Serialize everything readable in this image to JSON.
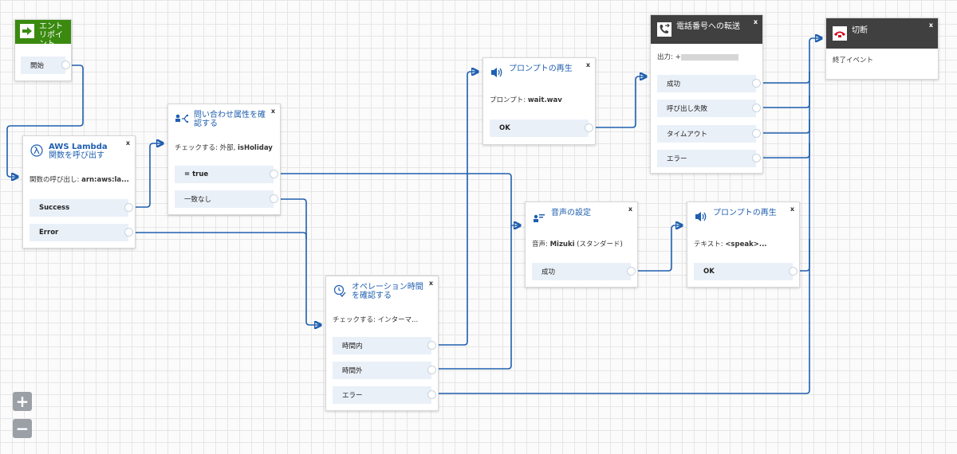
{
  "entry": {
    "title": "エントリポイント",
    "branch": "開始"
  },
  "lambda": {
    "title_line1": "AWS Lambda",
    "title_line2": "関数を呼び出す",
    "desc_prefix": "関数の呼び出し: ",
    "desc_value": "arn:aws:la...",
    "branches": [
      "Success",
      "Error"
    ]
  },
  "check_attr": {
    "title": "問い合わせ属性を確認する",
    "desc_prefix": "チェックする: 外部, ",
    "desc_value": "isHoliday",
    "branches": [
      "= true",
      "一致なし"
    ]
  },
  "hours": {
    "title": "オペレーション時間を確認する",
    "desc": "チェックする: インターマ...",
    "branches": [
      "時間内",
      "時間外",
      "エラー"
    ]
  },
  "prompt1": {
    "title": "プロンプトの再生",
    "desc_prefix": "プロンプト: ",
    "desc_value": "wait.wav",
    "branch": "OK"
  },
  "voice": {
    "title": "音声の設定",
    "desc_prefix": "音声: ",
    "desc_value": "Mizuki",
    "desc_suffix": " (スタンダード)",
    "branch": "成功"
  },
  "prompt2": {
    "title": "プロンプトの再生",
    "desc_prefix": "テキスト: ",
    "desc_value": "<speak>...",
    "branch": "OK"
  },
  "transfer": {
    "title": "電話番号への転送",
    "desc_prefix": "出力: +",
    "branches": [
      "成功",
      "呼び出し失敗",
      "タイムアウト",
      "エラー"
    ]
  },
  "disconnect": {
    "title": "切断",
    "desc": "終了イベント"
  },
  "close_label": "x",
  "zoom": {
    "in": "+",
    "out": "−"
  },
  "colors": {
    "link": "#1f5fb0",
    "entry_green": "#3a8a10",
    "branch_bg": "#eaf0f8",
    "dark_header": "#404040",
    "phone_red": "#d0021b"
  }
}
